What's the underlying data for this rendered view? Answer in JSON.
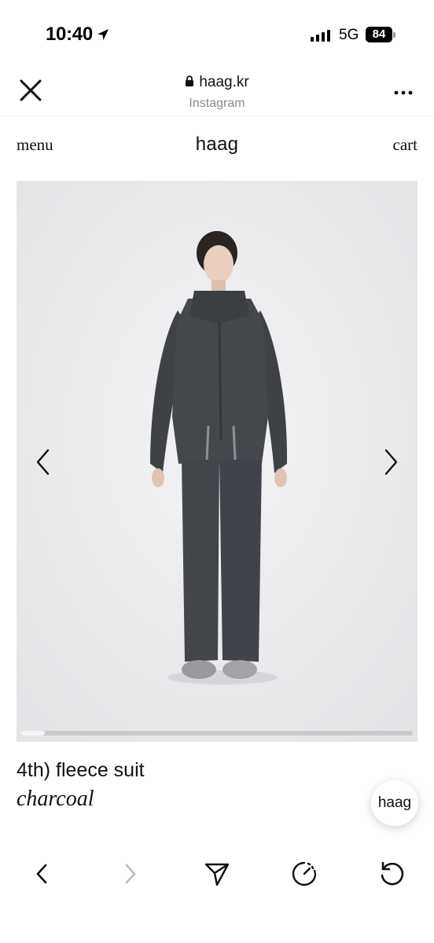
{
  "status_bar": {
    "time": "10:40",
    "network": "5G",
    "battery": "84"
  },
  "browser": {
    "url": "haag.kr",
    "source": "Instagram"
  },
  "site": {
    "menu_label": "menu",
    "logo": "haag",
    "cart_label": "cart"
  },
  "gallery": {
    "scroll_progress": 0.06
  },
  "product": {
    "title": "4th) fleece suit",
    "color": "charcoal"
  },
  "chat": {
    "label": "haag"
  },
  "toolbar": {
    "icons": [
      "back-icon",
      "forward-icon",
      "share-icon",
      "speed-icon",
      "reload-icon"
    ]
  }
}
